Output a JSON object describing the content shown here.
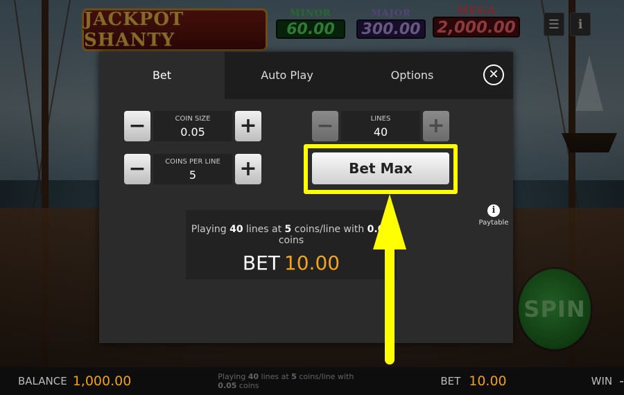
{
  "game": {
    "logo_text": "JACKPOT SHANTY"
  },
  "jackpots": {
    "minor": {
      "label": "MINOR",
      "value": "60.00"
    },
    "major": {
      "label": "MAJOR",
      "value": "300.00"
    },
    "mega": {
      "label": "MEGA",
      "value": "2,000.00"
    }
  },
  "top_buttons": {
    "menu_icon": "hamburger-menu-icon",
    "info_icon": "info-icon",
    "menu_glyph": "☰",
    "info_glyph": "ℹ"
  },
  "dialog": {
    "tabs": [
      {
        "label": "Bet",
        "active": true
      },
      {
        "label": "Auto Play",
        "active": false
      },
      {
        "label": "Options",
        "active": false
      }
    ],
    "close_glyph": "✕",
    "coin_size": {
      "label": "COIN SIZE",
      "value": "0.05"
    },
    "coins_per_line": {
      "label": "COINS PER LINE",
      "value": "5"
    },
    "lines": {
      "label": "LINES",
      "value": "40"
    },
    "minus_glyph": "−",
    "plus_glyph": "+",
    "bet_max_label": "Bet Max",
    "summary": {
      "prefix": "Playing ",
      "lines": "40",
      "mid1": " lines at ",
      "coins": "5",
      "mid2": " coins/line with ",
      "coin_size": "0.05",
      "suffix": " coins",
      "bet_label": "BET",
      "bet_amount": "10.00"
    },
    "paytable": {
      "icon_glyph": "i",
      "label": "Paytable"
    }
  },
  "spin": {
    "label": "SPIN"
  },
  "bottom_bar": {
    "balance_label": "BALANCE",
    "balance_amount": "1,000.00",
    "playing_prefix": "Playing ",
    "playing_lines": "40",
    "playing_mid1": " lines at ",
    "playing_coins": "5",
    "playing_mid2": " coins/line with ",
    "playing_size": "0.05",
    "playing_suffix": " coins",
    "bet_label": "BET",
    "bet_amount": "10.00",
    "win_label": "WIN",
    "win_amount": "-"
  },
  "colors": {
    "highlight": "#ffff00",
    "accent_amount": "#f7a41d",
    "spin_green": "#2ea63b"
  }
}
